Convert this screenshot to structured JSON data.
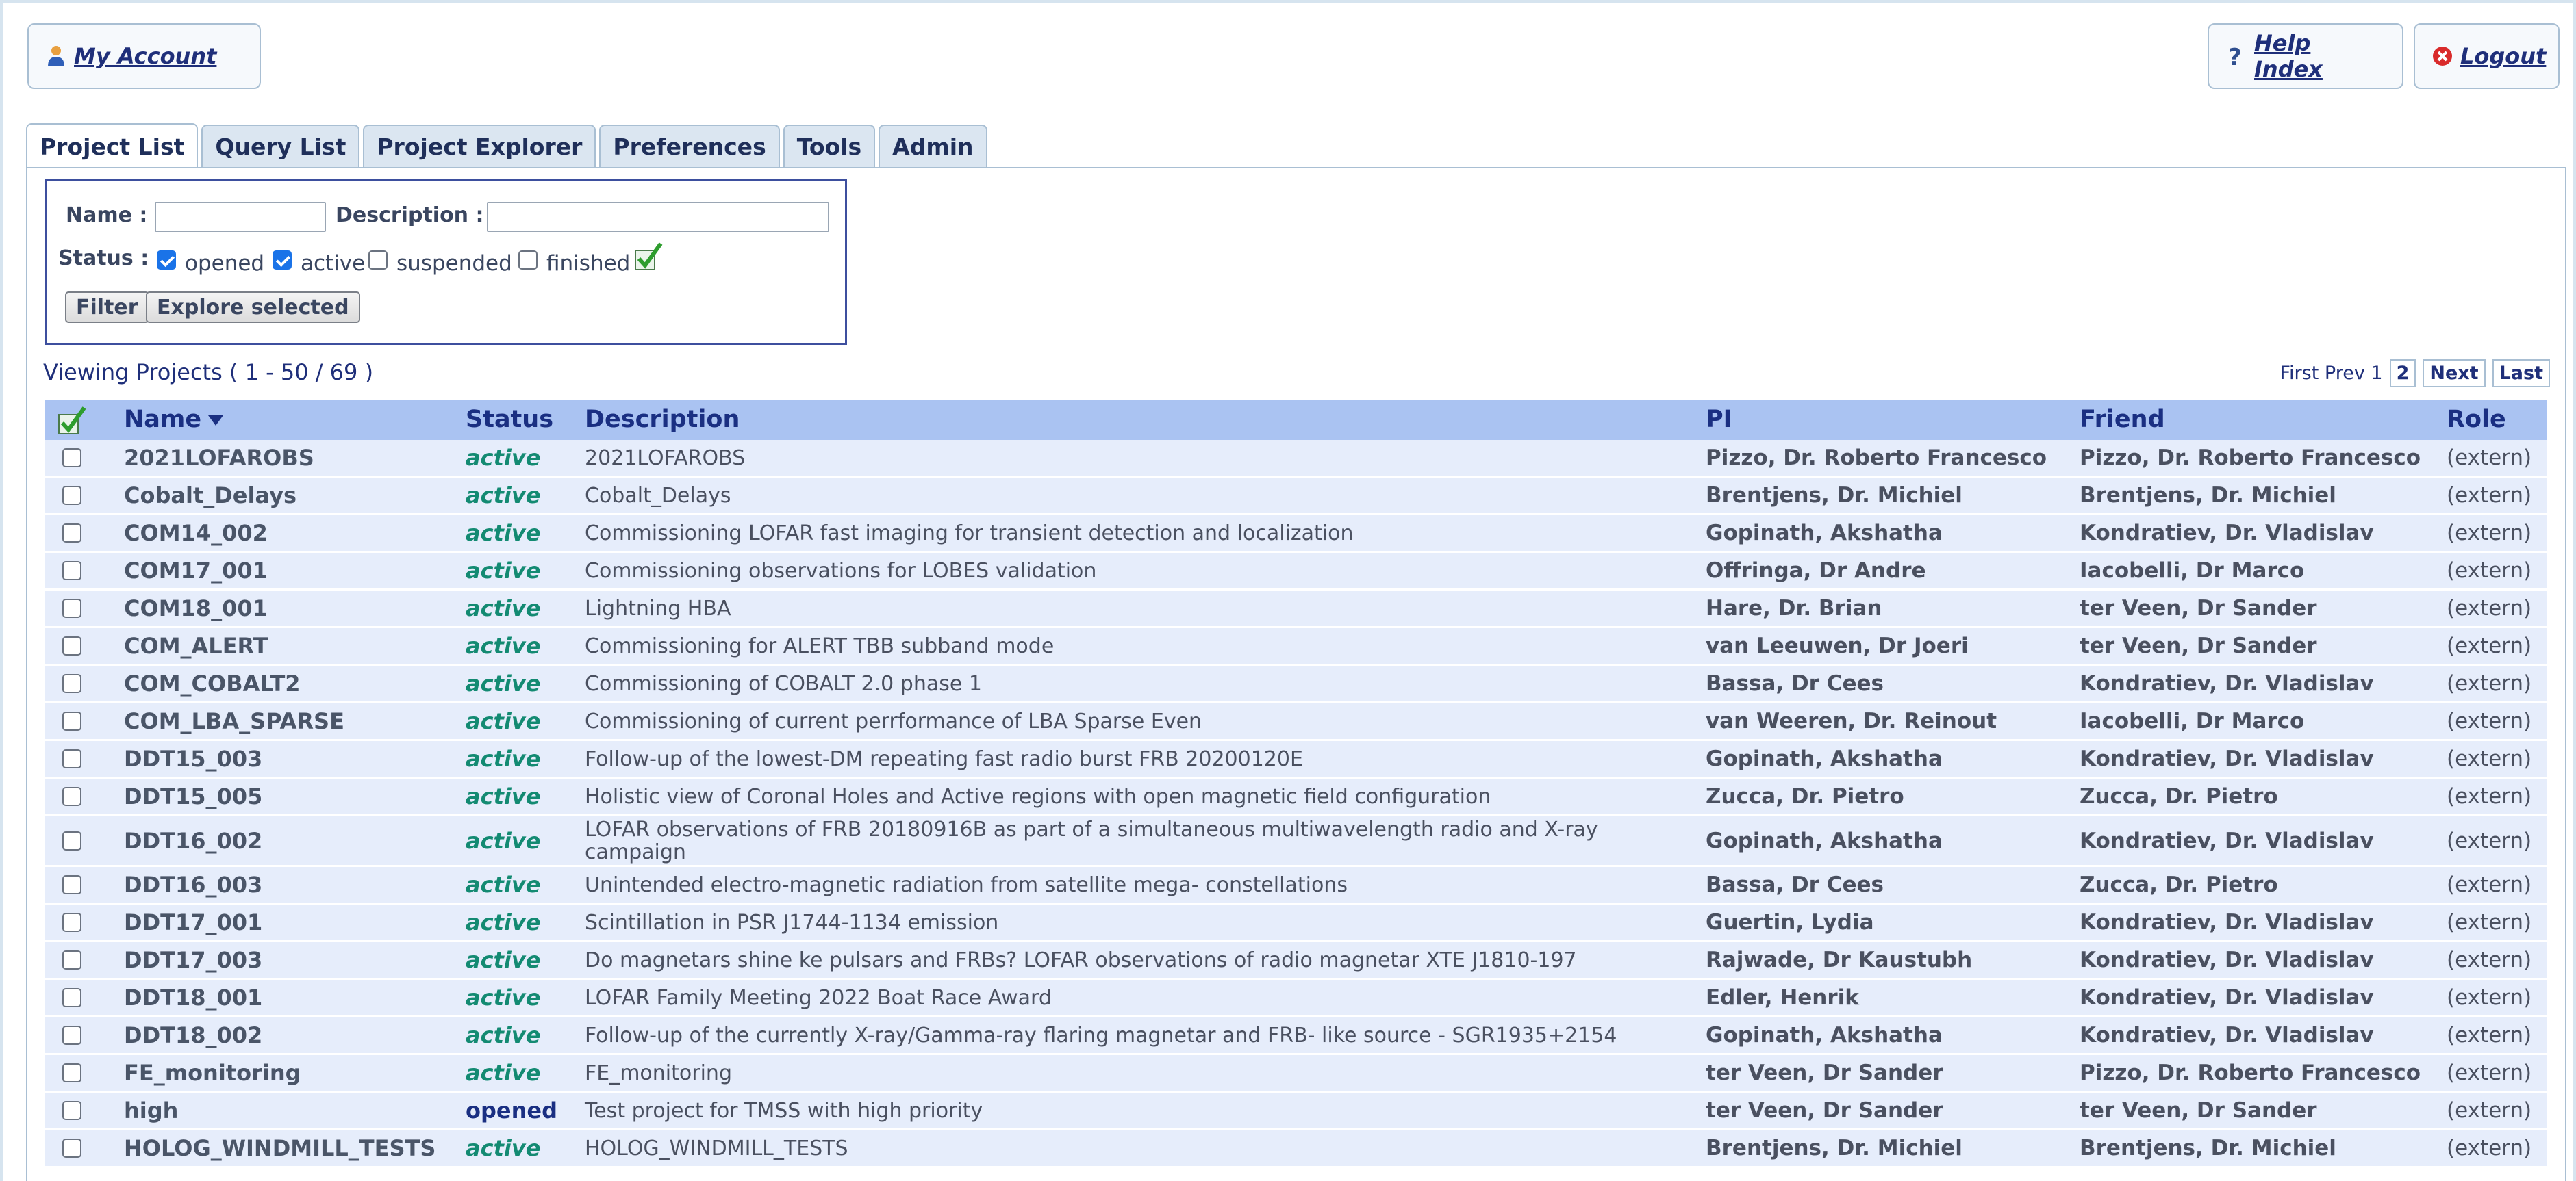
{
  "header": {
    "my_account_label": "My Account",
    "help_index_label": "Help Index",
    "logout_label": "Logout"
  },
  "tabs": [
    {
      "label": "Project List",
      "active": true
    },
    {
      "label": "Query List"
    },
    {
      "label": "Project Explorer"
    },
    {
      "label": "Preferences"
    },
    {
      "label": "Tools"
    },
    {
      "label": "Admin"
    }
  ],
  "filter": {
    "name_label": "Name :",
    "name_value": "",
    "description_label": "Description :",
    "description_value": "",
    "status_label": "Status :",
    "statuses": [
      {
        "label": "opened",
        "checked": true
      },
      {
        "label": "active",
        "checked": true
      },
      {
        "label": "suspended",
        "checked": false
      },
      {
        "label": "finished",
        "checked": false
      }
    ],
    "filter_button": "Filter",
    "explore_button": "Explore selected"
  },
  "viewing_text": "Viewing Projects ( 1 - 50 / 69 )",
  "pager": {
    "first_prev": "First Prev 1",
    "page2": "2",
    "next": "Next",
    "last": "Last"
  },
  "table": {
    "columns": {
      "name": "Name",
      "status": "Status",
      "description": "Description",
      "pi": "PI",
      "friend": "Friend",
      "role": "Role"
    },
    "rows": [
      {
        "name": "2021LOFAROBS",
        "status": "active",
        "description": "2021LOFAROBS",
        "pi": "Pizzo, Dr. Roberto Francesco",
        "friend": "Pizzo, Dr. Roberto Francesco",
        "role": "(extern)"
      },
      {
        "name": "Cobalt_Delays",
        "status": "active",
        "description": "Cobalt_Delays",
        "pi": "Brentjens, Dr. Michiel",
        "friend": "Brentjens, Dr. Michiel",
        "role": "(extern)"
      },
      {
        "name": "COM14_002",
        "status": "active",
        "description": "Commissioning LOFAR fast imaging for transient detection and localization",
        "pi": "Gopinath, Akshatha",
        "friend": "Kondratiev, Dr. Vladislav",
        "role": "(extern)"
      },
      {
        "name": "COM17_001",
        "status": "active",
        "description": "Commissioning observations for LOBES validation",
        "pi": "Offringa, Dr Andre",
        "friend": "Iacobelli, Dr Marco",
        "role": "(extern)"
      },
      {
        "name": "COM18_001",
        "status": "active",
        "description": "Lightning HBA",
        "pi": "Hare, Dr. Brian",
        "friend": "ter Veen, Dr Sander",
        "role": "(extern)"
      },
      {
        "name": "COM_ALERT",
        "status": "active",
        "description": "Commissioning for ALERT TBB subband mode",
        "pi": "van Leeuwen, Dr Joeri",
        "friend": "ter Veen, Dr Sander",
        "role": "(extern)"
      },
      {
        "name": "COM_COBALT2",
        "status": "active",
        "description": "Commissioning of COBALT 2.0 phase 1",
        "pi": "Bassa, Dr Cees",
        "friend": "Kondratiev, Dr. Vladislav",
        "role": "(extern)"
      },
      {
        "name": "COM_LBA_SPARSE",
        "status": "active",
        "description": "Commissioning of current perrformance of LBA Sparse Even",
        "pi": "van Weeren, Dr. Reinout",
        "friend": "Iacobelli, Dr Marco",
        "role": "(extern)"
      },
      {
        "name": "DDT15_003",
        "status": "active",
        "description": "Follow-up of the lowest-DM repeating fast radio burst FRB 20200120E",
        "pi": "Gopinath, Akshatha",
        "friend": "Kondratiev, Dr. Vladislav",
        "role": "(extern)"
      },
      {
        "name": "DDT15_005",
        "status": "active",
        "description": "Holistic view of Coronal Holes and Active regions with open magnetic field configuration",
        "pi": "Zucca, Dr. Pietro",
        "friend": "Zucca, Dr. Pietro",
        "role": "(extern)"
      },
      {
        "name": "DDT16_002",
        "status": "active",
        "description": "LOFAR observations of FRB 20180916B as part of a simultaneous multiwavelength radio and X-ray campaign",
        "pi": "Gopinath, Akshatha",
        "friend": "Kondratiev, Dr. Vladislav",
        "role": "(extern)",
        "tall": true
      },
      {
        "name": "DDT16_003",
        "status": "active",
        "description": "Unintended electro-magnetic radiation from satellite mega- constellations",
        "pi": "Bassa, Dr Cees",
        "friend": "Zucca, Dr. Pietro",
        "role": "(extern)"
      },
      {
        "name": "DDT17_001",
        "status": "active",
        "description": "Scintillation in PSR J1744-1134 emission",
        "pi": "Guertin, Lydia",
        "friend": "Kondratiev, Dr. Vladislav",
        "role": "(extern)"
      },
      {
        "name": "DDT17_003",
        "status": "active",
        "description": "Do magnetars shine ke pulsars and FRBs? LOFAR observations of radio magnetar XTE J1810-197",
        "pi": "Rajwade, Dr Kaustubh",
        "friend": "Kondratiev, Dr. Vladislav",
        "role": "(extern)"
      },
      {
        "name": "DDT18_001",
        "status": "active",
        "description": "LOFAR Family Meeting 2022 Boat Race Award",
        "pi": "Edler, Henrik",
        "friend": "Kondratiev, Dr. Vladislav",
        "role": "(extern)"
      },
      {
        "name": "DDT18_002",
        "status": "active",
        "description": "Follow-up of the currently X-ray/Gamma-ray flaring magnetar and FRB- like source - SGR1935+2154",
        "pi": "Gopinath, Akshatha",
        "friend": "Kondratiev, Dr. Vladislav",
        "role": "(extern)"
      },
      {
        "name": "FE_monitoring",
        "status": "active",
        "description": "FE_monitoring",
        "pi": "ter Veen, Dr Sander",
        "friend": "Pizzo, Dr. Roberto Francesco",
        "role": "(extern)"
      },
      {
        "name": "high",
        "status": "opened",
        "description": "Test project for TMSS with high priority",
        "pi": "ter Veen, Dr Sander",
        "friend": "ter Veen, Dr Sander",
        "role": "(extern)"
      },
      {
        "name": "HOLOG_WINDMILL_TESTS",
        "status": "active",
        "description": "HOLOG_WINDMILL_TESTS",
        "pi": "Brentjens, Dr. Michiel",
        "friend": "Brentjens, Dr. Michiel",
        "role": "(extern)"
      }
    ]
  },
  "colors": {
    "header_bg": "#aac3f2",
    "row_bg": "#e6edfb",
    "active_status": "#138a72",
    "link": "#1f2f7a"
  }
}
